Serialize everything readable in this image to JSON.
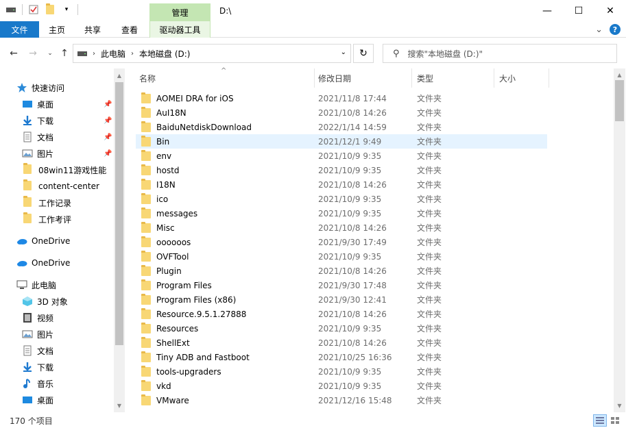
{
  "window": {
    "title": "D:\\",
    "context_tab_header": "管理",
    "minimize": "—",
    "maximize": "☐",
    "close": "✕"
  },
  "ribbon": {
    "tabs": [
      {
        "label": "文件"
      },
      {
        "label": "主页"
      },
      {
        "label": "共享"
      },
      {
        "label": "查看"
      },
      {
        "label": "驱动器工具"
      }
    ],
    "collapse_glyph": "⌄",
    "help_glyph": "?"
  },
  "addressbar": {
    "segments": [
      "此电脑",
      "本地磁盘 (D:)"
    ],
    "search_placeholder": "搜索\"本地磁盘 (D:)\""
  },
  "navpane": {
    "quick_access": "快速访问",
    "pinned": [
      {
        "label": "桌面",
        "icon": "desktop-icon"
      },
      {
        "label": "下载",
        "icon": "download-icon"
      },
      {
        "label": "文档",
        "icon": "document-icon"
      },
      {
        "label": "图片",
        "icon": "picture-icon"
      }
    ],
    "recent": [
      {
        "label": "08win11游戏性能"
      },
      {
        "label": "content-center"
      },
      {
        "label": "工作记录"
      },
      {
        "label": "工作考评"
      }
    ],
    "onedrive": [
      "OneDrive",
      "OneDrive"
    ],
    "this_pc": "此电脑",
    "pc_items": [
      {
        "label": "3D 对象",
        "icon": "3d-objects-icon"
      },
      {
        "label": "视频",
        "icon": "video-icon"
      },
      {
        "label": "图片",
        "icon": "picture-icon"
      },
      {
        "label": "文档",
        "icon": "document-icon"
      },
      {
        "label": "下载",
        "icon": "download-icon"
      },
      {
        "label": "音乐",
        "icon": "music-icon"
      },
      {
        "label": "桌面",
        "icon": "desktop-icon"
      }
    ]
  },
  "columns": {
    "name": "名称",
    "date": "修改日期",
    "type": "类型",
    "size": "大小"
  },
  "files": [
    {
      "name": "AOMEI DRA for iOS",
      "date": "2021/11/8 17:44",
      "type": "文件夹"
    },
    {
      "name": "AuI18N",
      "date": "2021/10/8 14:26",
      "type": "文件夹"
    },
    {
      "name": "BaiduNetdiskDownload",
      "date": "2022/1/14 14:59",
      "type": "文件夹"
    },
    {
      "name": "Bin",
      "date": "2021/12/1 9:49",
      "type": "文件夹",
      "selected": true
    },
    {
      "name": "env",
      "date": "2021/10/9 9:35",
      "type": "文件夹"
    },
    {
      "name": "hostd",
      "date": "2021/10/9 9:35",
      "type": "文件夹"
    },
    {
      "name": "I18N",
      "date": "2021/10/8 14:26",
      "type": "文件夹"
    },
    {
      "name": "ico",
      "date": "2021/10/9 9:35",
      "type": "文件夹"
    },
    {
      "name": "messages",
      "date": "2021/10/9 9:35",
      "type": "文件夹"
    },
    {
      "name": "Misc",
      "date": "2021/10/8 14:26",
      "type": "文件夹"
    },
    {
      "name": "oooooos",
      "date": "2021/9/30 17:49",
      "type": "文件夹"
    },
    {
      "name": "OVFTool",
      "date": "2021/10/9 9:35",
      "type": "文件夹"
    },
    {
      "name": "Plugin",
      "date": "2021/10/8 14:26",
      "type": "文件夹"
    },
    {
      "name": "Program Files",
      "date": "2021/9/30 17:48",
      "type": "文件夹"
    },
    {
      "name": "Program Files (x86)",
      "date": "2021/9/30 12:41",
      "type": "文件夹"
    },
    {
      "name": "Resource.9.5.1.27888",
      "date": "2021/10/8 14:26",
      "type": "文件夹"
    },
    {
      "name": "Resources",
      "date": "2021/10/9 9:35",
      "type": "文件夹"
    },
    {
      "name": "ShellExt",
      "date": "2021/10/8 14:26",
      "type": "文件夹"
    },
    {
      "name": "Tiny ADB and Fastboot",
      "date": "2021/10/25 16:36",
      "type": "文件夹"
    },
    {
      "name": "tools-upgraders",
      "date": "2021/10/9 9:35",
      "type": "文件夹"
    },
    {
      "name": "vkd",
      "date": "2021/10/9 9:35",
      "type": "文件夹"
    },
    {
      "name": "VMware",
      "date": "2021/12/16 15:48",
      "type": "文件夹"
    }
  ],
  "status": {
    "item_count": "170 个项目"
  },
  "colors": {
    "accent": "#1979ca",
    "context_tab": "#c4e6b3",
    "selection": "#e5f3ff",
    "folder": "#f8d775"
  }
}
